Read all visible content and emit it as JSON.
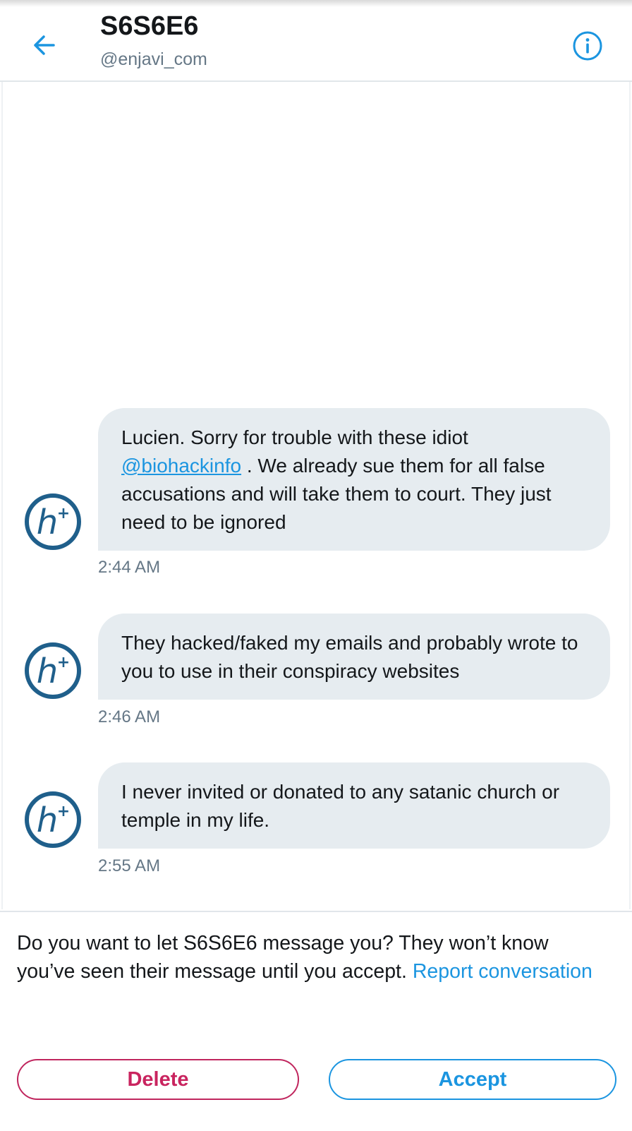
{
  "header": {
    "title": "S6S6E6",
    "handle": "@enjavi_com"
  },
  "messages": [
    {
      "text_before": "Lucien. Sorry for trouble with these idiot ",
      "mention": "@biohackinfo",
      "text_after": " . We already sue them for all false accusations and will take them to court. They just need to be ignored",
      "time": "2:44 AM"
    },
    {
      "text": "They hacked/faked my emails and probably wrote to you to use in their conspiracy websites",
      "time": "2:46 AM"
    },
    {
      "text": "I never invited or donated to any satanic church or temple in my life.",
      "time": "2:55 AM"
    }
  ],
  "avatar": {
    "letter": "h",
    "superscript": "+",
    "color": "#1f5f8b"
  },
  "request": {
    "prompt": "Do you want to let S6S6E6 message you? They won’t know you’ve seen their message until you accept. ",
    "report_link": "Report conversation",
    "delete_label": "Delete",
    "accept_label": "Accept"
  },
  "colors": {
    "accent": "#1b95e0",
    "delete": "#c9245f",
    "bubble": "#e6ecf0",
    "secondary_text": "#657786"
  },
  "icons": {
    "back": "arrow-left-icon",
    "info": "info-circle-icon",
    "avatar": "h-plus-logo"
  }
}
